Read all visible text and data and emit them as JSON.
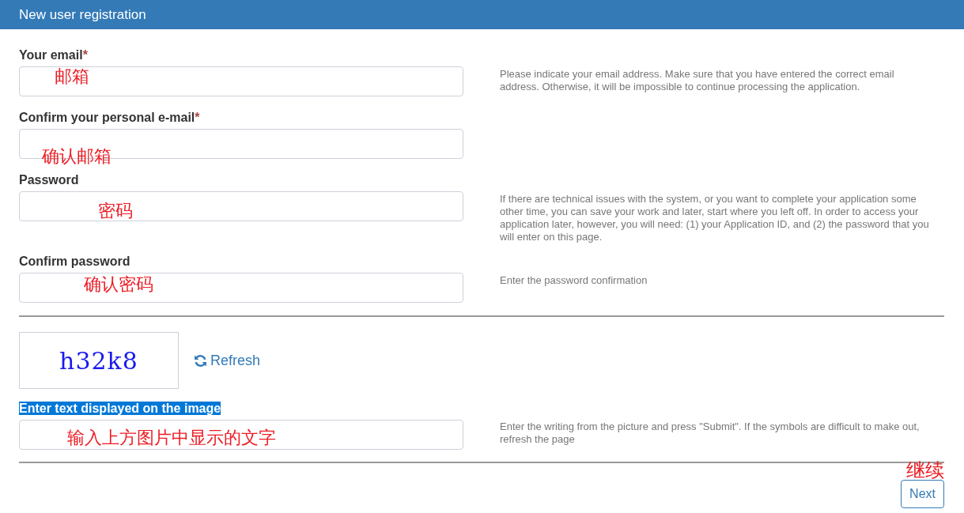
{
  "header": {
    "title": "New user registration"
  },
  "fields": [
    {
      "label": "Your email",
      "required_mark": "*",
      "annotation": "邮箱",
      "help": "Please indicate your email address. Make sure that you have entered the correct email address. Otherwise, it will be impossible to continue processing the application."
    },
    {
      "label": "Confirm your personal e-mail",
      "required_mark": "*",
      "annotation": "确认邮箱"
    },
    {
      "label": "Password",
      "annotation": "密码",
      "help": "If there are technical issues with the system, or you want to complete your application some other time, you can save your work and later, start where you left off. In order to access your application later, however, you will need: (1) your Application ID, and (2) the password that you will enter on this page."
    },
    {
      "label": "Confirm password",
      "annotation": "确认密码",
      "help": "Enter the password confirmation"
    }
  ],
  "captcha": {
    "text": "h32k8",
    "refresh": "Refresh",
    "label": "Enter text displayed on the image",
    "label_highlighted": true,
    "annotation": "输入上方图片中显示的文字",
    "help": "Enter the writing from the picture and press \"Submit\". If the symbols are difficult to make out, refresh the page"
  },
  "next_button": {
    "label": "Next",
    "annotation": "继续"
  }
}
